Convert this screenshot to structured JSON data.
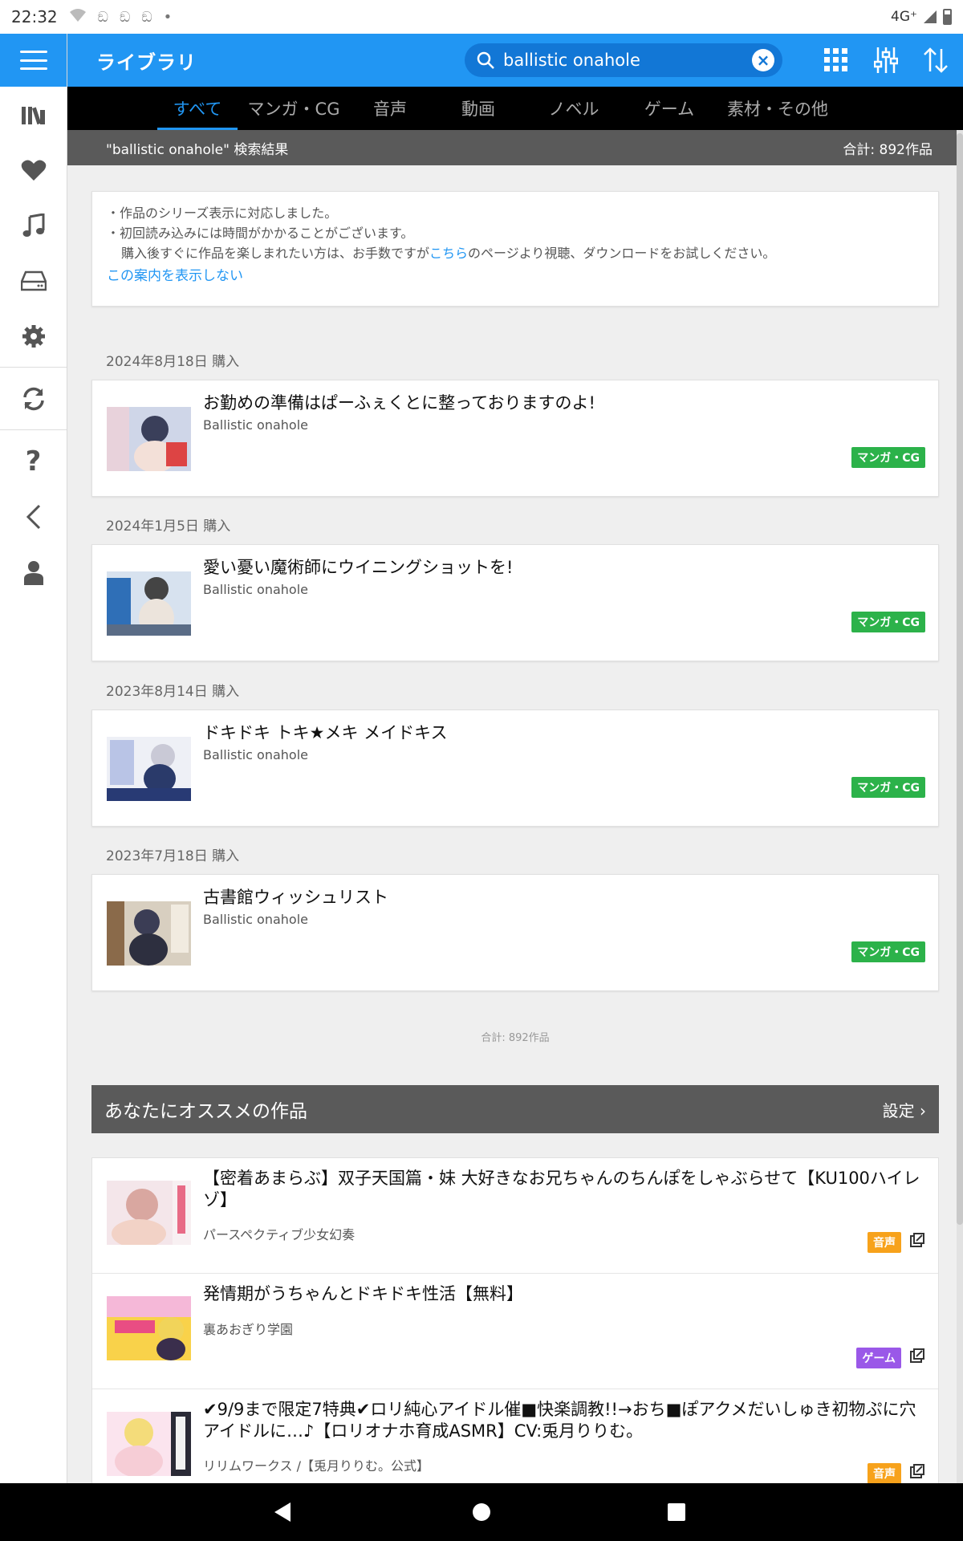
{
  "status_bar": {
    "time": "22:32",
    "network": "4G⁺"
  },
  "app_bar": {
    "title": "ライブラリ",
    "search_query": "ballistic onahole"
  },
  "tabs": [
    {
      "label": "すべて",
      "active": true
    },
    {
      "label": "マンガ・CG",
      "active": false
    },
    {
      "label": "音声",
      "active": false
    },
    {
      "label": "動画",
      "active": false
    },
    {
      "label": "ノベル",
      "active": false
    },
    {
      "label": "ゲーム",
      "active": false
    },
    {
      "label": "素材・その他",
      "active": false
    }
  ],
  "results": {
    "query_label": "\"ballistic onahole\" 検索結果",
    "total": "合計: 892作品"
  },
  "notice": {
    "line1": "・作品のシリーズ表示に対応しました。",
    "line2": "・初回読み込みには時間がかかることがございます。",
    "line3_pre": "購入後すぐに作品を楽しまれたい方は、お手数ですが",
    "line3_link": "こちら",
    "line3_post": "のページより視聴、ダウンロードをお試しください。",
    "hide_link": "この案内を表示しない"
  },
  "purchases": [
    {
      "date": "2024年8月18日 購入",
      "title": "お勤めの準備はぱーふぇくとに整っておりますのよ!",
      "author": "Ballistic onahole",
      "category": "マンガ・CG"
    },
    {
      "date": "2024年1月5日 購入",
      "title": "愛い憂い魔術師にウイニングショットを!",
      "author": "Ballistic onahole",
      "category": "マンガ・CG"
    },
    {
      "date": "2023年8月14日 購入",
      "title": "ドキドキ トキ★メキ メイドキス",
      "author": "Ballistic onahole",
      "category": "マンガ・CG"
    },
    {
      "date": "2023年7月18日 購入",
      "title": "古書館ウィッシュリスト",
      "author": "Ballistic onahole",
      "category": "マンガ・CG"
    }
  ],
  "total_footer": "合計: 892作品",
  "recommend": {
    "title": "あなたにオススメの作品",
    "settings_label": "設定",
    "items": [
      {
        "title": "【密着あまらぶ】双子天国篇・妹 大好きなお兄ちゃんのちんぽをしゃぶらせて【KU100ハイレゾ】",
        "author": "パースペクティブ少女幻奏",
        "category": "音声"
      },
      {
        "title": "発情期がうちゃんとドキドキ性活【無料】",
        "author": "裏あおぎり学園",
        "category": "ゲーム"
      },
      {
        "title": "✔9/9まで限定7特典✔ロリ純心アイドル催■快楽調教!!→おち■ぽアクメだいしゅき初物ぷに穴アイドルに…♪【ロリオナホ育成ASMR】CV:兎月りりむ。",
        "author": "リリムワークス /【兎月りりむ。公式】",
        "category": "音声"
      }
    ]
  },
  "colors": {
    "accent": "#2196f3",
    "manga_badge": "#2cb24a",
    "audio_badge": "#f7a21b",
    "game_badge": "#9a58e8",
    "header_gray": "#5a5a5a"
  }
}
